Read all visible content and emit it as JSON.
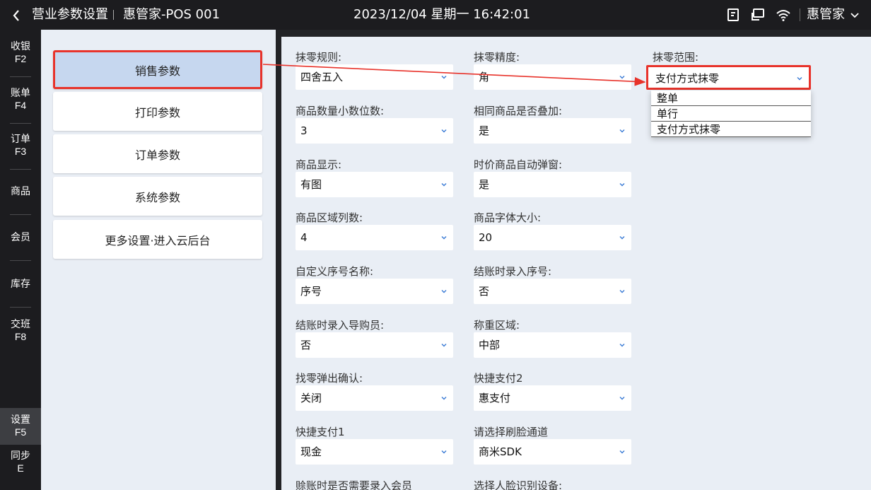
{
  "topbar": {
    "back_icon": "chevron-left-icon",
    "title": "营业参数设置",
    "store": "惠管家-POS 001",
    "datetime": "2023/12/04 星期一 16:42:01",
    "icons": [
      "receipt-icon",
      "cast-icon",
      "wifi-icon"
    ],
    "user": "惠管家"
  },
  "leftnav": [
    {
      "label": "收银",
      "key": "F2"
    },
    {
      "label": "账单",
      "key": "F4"
    },
    {
      "label": "订单",
      "key": "F3"
    },
    {
      "label": "商品",
      "key": ""
    },
    {
      "label": "会员",
      "key": ""
    },
    {
      "label": "库存",
      "key": ""
    },
    {
      "label": "交班",
      "key": "F8"
    },
    {
      "label": "设置",
      "key": "F5"
    },
    {
      "label": "同步",
      "key": "E"
    }
  ],
  "tabs": [
    "销售参数",
    "打印参数",
    "订单参数",
    "系统参数",
    "更多设置·进入云后台"
  ],
  "fields": [
    {
      "label": "抹零规则:",
      "value": "四舍五入"
    },
    {
      "label": "抹零精度:",
      "value": "角"
    },
    {
      "label": "抹零范围:",
      "value": "支付方式抹零"
    },
    {
      "label": "商品数量小数位数:",
      "value": "3"
    },
    {
      "label": "相同商品是否叠加:",
      "value": "是"
    },
    {
      "label": "商品显示:",
      "value": "有图"
    },
    {
      "label": "时价商品自动弹窗:",
      "value": "是"
    },
    {
      "label": "商品区域列数:",
      "value": "4"
    },
    {
      "label": "商品字体大小:",
      "value": "20"
    },
    {
      "label": "自定义序号名称:",
      "value": "序号"
    },
    {
      "label": "结账时录入序号:",
      "value": "否"
    },
    {
      "label": "结账时录入导购员:",
      "value": "否"
    },
    {
      "label": "称重区域:",
      "value": "中部"
    },
    {
      "label": "找零弹出确认:",
      "value": "关闭"
    },
    {
      "label": "快捷支付2",
      "value": "惠支付"
    },
    {
      "label": "快捷支付1",
      "value": "现金"
    },
    {
      "label": "请选择刷脸通道",
      "value": "商米SDK"
    },
    {
      "label": "赊账时是否需要录入会员",
      "value": ""
    },
    {
      "label": "选择人脸识别设备:",
      "value": ""
    }
  ],
  "dropdown_options": [
    "整单",
    "单行",
    "支付方式抹零"
  ],
  "colors": {
    "highlight": "#e8332b",
    "active_tab": "#c6d7ef",
    "chevron": "#3a7bd5"
  }
}
